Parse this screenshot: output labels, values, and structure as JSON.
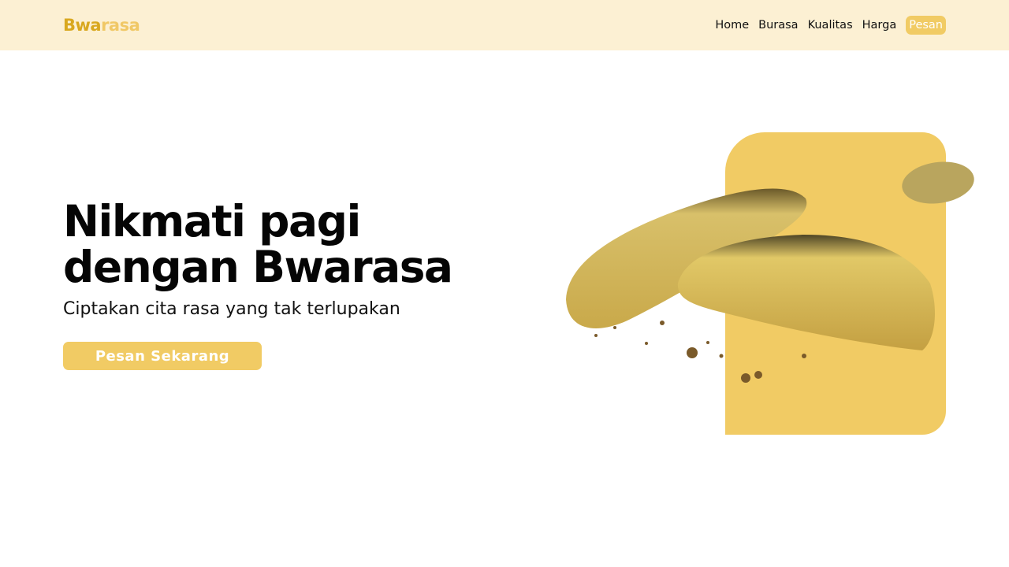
{
  "brand": {
    "part1": "Bwa",
    "part2": "rasa"
  },
  "nav": {
    "items": [
      "Home",
      "Burasa",
      "Kualitas",
      "Harga"
    ],
    "cta": "Pesan"
  },
  "hero": {
    "title": "Nikmati pagi dengan Bwarasa",
    "subtitle": "Ciptakan cita rasa yang tak terlupakan",
    "button": "Pesan Sekarang"
  },
  "colors": {
    "navbar_bg": "#fcf0d3",
    "brand_dark": "#d9a81f",
    "brand_light": "#f0c866",
    "accent": "#f1cb64"
  },
  "image": {
    "description_icon": "cookie-image"
  }
}
